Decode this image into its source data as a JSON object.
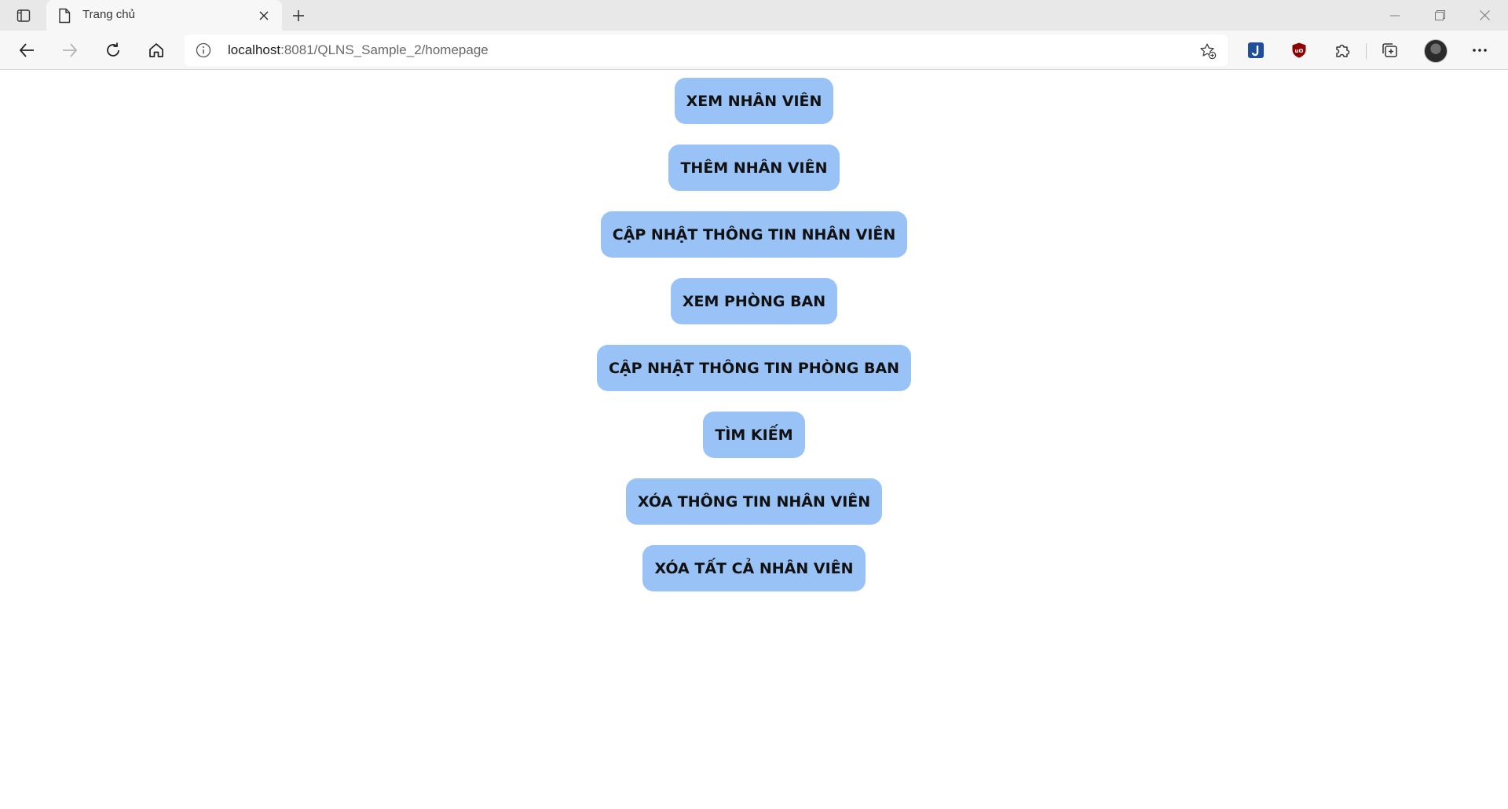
{
  "browser": {
    "tab": {
      "title": "Trang chủ",
      "close_icon": "close-icon",
      "favicon_icon": "document-icon"
    },
    "address": {
      "host": "localhost",
      "rest": ":8081/QLNS_Sample_2/homepage"
    },
    "icons": {
      "back": "arrow-left-icon",
      "forward": "arrow-right-icon",
      "reload": "reload-icon",
      "home": "home-icon",
      "info": "info-icon",
      "favorite": "star-add-icon",
      "extensions": [
        "j-extension-icon",
        "ublock-icon",
        "puzzle-icon",
        "collections-icon"
      ],
      "more": "more-icon"
    },
    "colors": {
      "tabstrip_bg": "#e8e8e8",
      "toolbar_bg": "#f7f7f7"
    }
  },
  "page": {
    "menu": [
      {
        "label": "XEM NHÂN VIÊN"
      },
      {
        "label": "THÊM NHÂN VIÊN"
      },
      {
        "label": "CẬP NHẬT THÔNG TIN NHÂN VIÊN"
      },
      {
        "label": "XEM PHÒNG BAN"
      },
      {
        "label": "CẬP NHẬT THÔNG TIN PHÒNG BAN"
      },
      {
        "label": "TÌM KIẾM"
      },
      {
        "label": "XÓA THÔNG TIN NHÂN VIÊN"
      },
      {
        "label": "XÓA TẤT CẢ NHÂN VIÊN"
      }
    ],
    "colors": {
      "button_bg": "#99c2f7",
      "button_text": "#111111"
    }
  }
}
